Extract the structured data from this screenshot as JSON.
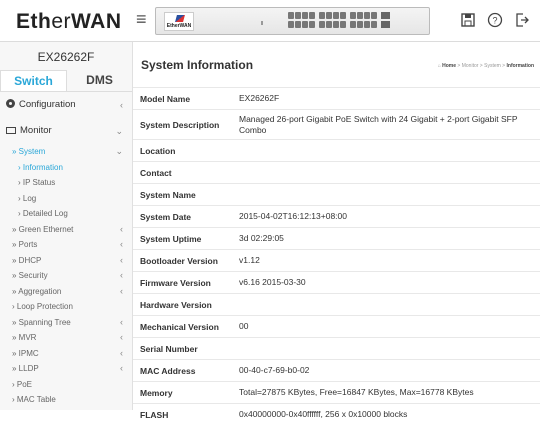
{
  "brand": {
    "logo_bold": "Eth",
    "logo_rest": "er",
    "logo_bold2": "WAN"
  },
  "device_image": {
    "brand_text": "EtherWAN"
  },
  "sidebar": {
    "model": "EX26262F",
    "tabs": [
      "Switch",
      "DMS"
    ],
    "nav": [
      {
        "label": "Configuration",
        "level": "top",
        "chev": "‹"
      },
      {
        "label": "Monitor",
        "level": "top",
        "chev": "⌄"
      },
      {
        "label": "» System",
        "level": "sub",
        "chev": "⌄",
        "active": true
      },
      {
        "label": "› Information",
        "level": "subsub",
        "active": true
      },
      {
        "label": "› IP Status",
        "level": "subsub"
      },
      {
        "label": "› Log",
        "level": "subsub"
      },
      {
        "label": "› Detailed Log",
        "level": "subsub"
      },
      {
        "label": "» Green Ethernet",
        "level": "sub",
        "chev": "‹"
      },
      {
        "label": "» Ports",
        "level": "sub",
        "chev": "‹"
      },
      {
        "label": "» DHCP",
        "level": "sub",
        "chev": "‹"
      },
      {
        "label": "» Security",
        "level": "sub",
        "chev": "‹"
      },
      {
        "label": "» Aggregation",
        "level": "sub",
        "chev": "‹"
      },
      {
        "label": "› Loop Protection",
        "level": "sub"
      },
      {
        "label": "» Spanning Tree",
        "level": "sub",
        "chev": "‹"
      },
      {
        "label": "» MVR",
        "level": "sub",
        "chev": "‹"
      },
      {
        "label": "» IPMC",
        "level": "sub",
        "chev": "‹"
      },
      {
        "label": "» LLDP",
        "level": "sub",
        "chev": "‹"
      },
      {
        "label": "› PoE",
        "level": "sub"
      },
      {
        "label": "› MAC Table",
        "level": "sub"
      }
    ]
  },
  "main": {
    "title": "System Information",
    "breadcrumb": {
      "home": "Home",
      "items": [
        "Monitor",
        "System"
      ],
      "current": "Information",
      "sep": " > "
    },
    "rows": [
      {
        "key": "Model Name",
        "value": "EX26262F"
      },
      {
        "key": "System Description",
        "value": "Managed 26-port Gigabit PoE Switch with 24 Gigabit + 2-port Gigabit SFP Combo"
      },
      {
        "key": "Location",
        "value": ""
      },
      {
        "key": "Contact",
        "value": ""
      },
      {
        "key": "System Name",
        "value": ""
      },
      {
        "key": "System Date",
        "value": "2015-04-02T16:12:13+08:00"
      },
      {
        "key": "System Uptime",
        "value": "3d 02:29:05"
      },
      {
        "key": "Bootloader Version",
        "value": "v1.12"
      },
      {
        "key": "Firmware Version",
        "value": "v6.16 2015-03-30"
      },
      {
        "key": "Hardware Version",
        "value": ""
      },
      {
        "key": "Mechanical Version",
        "value": "00"
      },
      {
        "key": "Serial Number",
        "value": ""
      },
      {
        "key": "MAC Address",
        "value": "00-40-c7-69-b0-02"
      },
      {
        "key": "Memory",
        "value": "Total=27875 KBytes, Free=16847 KBytes, Max=16778 KBytes"
      },
      {
        "key": "FLASH",
        "value": "0x40000000-0x40ffffff, 256 x 0x10000 blocks"
      }
    ]
  },
  "colors": {
    "accent": "#2aa7d8"
  }
}
